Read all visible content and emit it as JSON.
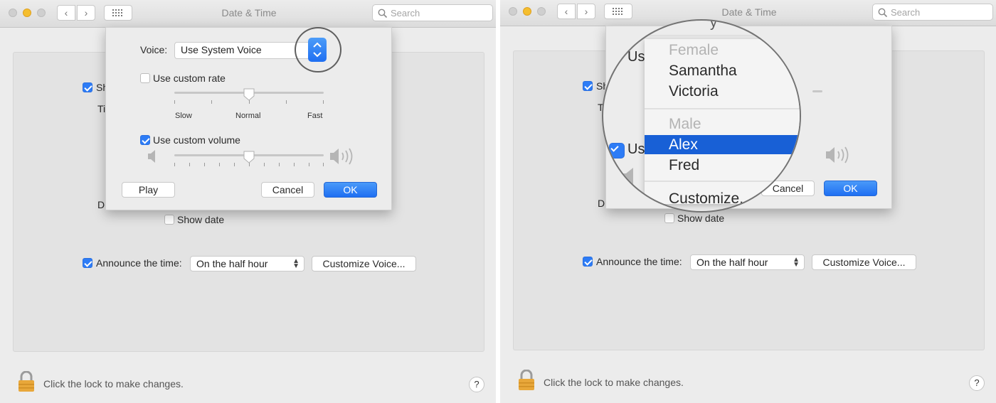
{
  "window": {
    "title": "Date & Time",
    "search_placeholder": "Search"
  },
  "main": {
    "show_checkbox_label_fragment": "Sh",
    "ti_fragment": "Ti",
    "d_fragment": "D",
    "show_date_label": "Show date",
    "announce_label": "Announce the time:",
    "announce_value": "On the half hour",
    "customize_voice_button": "Customize Voice..."
  },
  "sheet": {
    "voice_label": "Voice:",
    "voice_value": "Use System Voice",
    "use_custom_rate_label": "Use custom rate",
    "rate_ticks": {
      "slow": "Slow",
      "normal": "Normal",
      "fast": "Fast"
    },
    "use_custom_volume_label": "Use custom volume",
    "play_button": "Play",
    "cancel_button": "Cancel",
    "ok_button": "OK",
    "rate_value": 0.5,
    "volume_value": 0.5
  },
  "magnifier": {
    "top_fragment": "y",
    "us_fragment": "Us",
    "menu": {
      "female_header": "Female",
      "female_items": [
        "Samantha",
        "Victoria"
      ],
      "male_header": "Male",
      "male_items": [
        "Alex",
        "Fred"
      ],
      "selected": "Alex",
      "customize": "Customize..."
    }
  },
  "footer": {
    "lock_text": "Click the lock to make changes.",
    "help": "?"
  },
  "colors": {
    "accent": "#2d7cf6",
    "selection": "#1860d6",
    "lock": "#e8a73a"
  }
}
